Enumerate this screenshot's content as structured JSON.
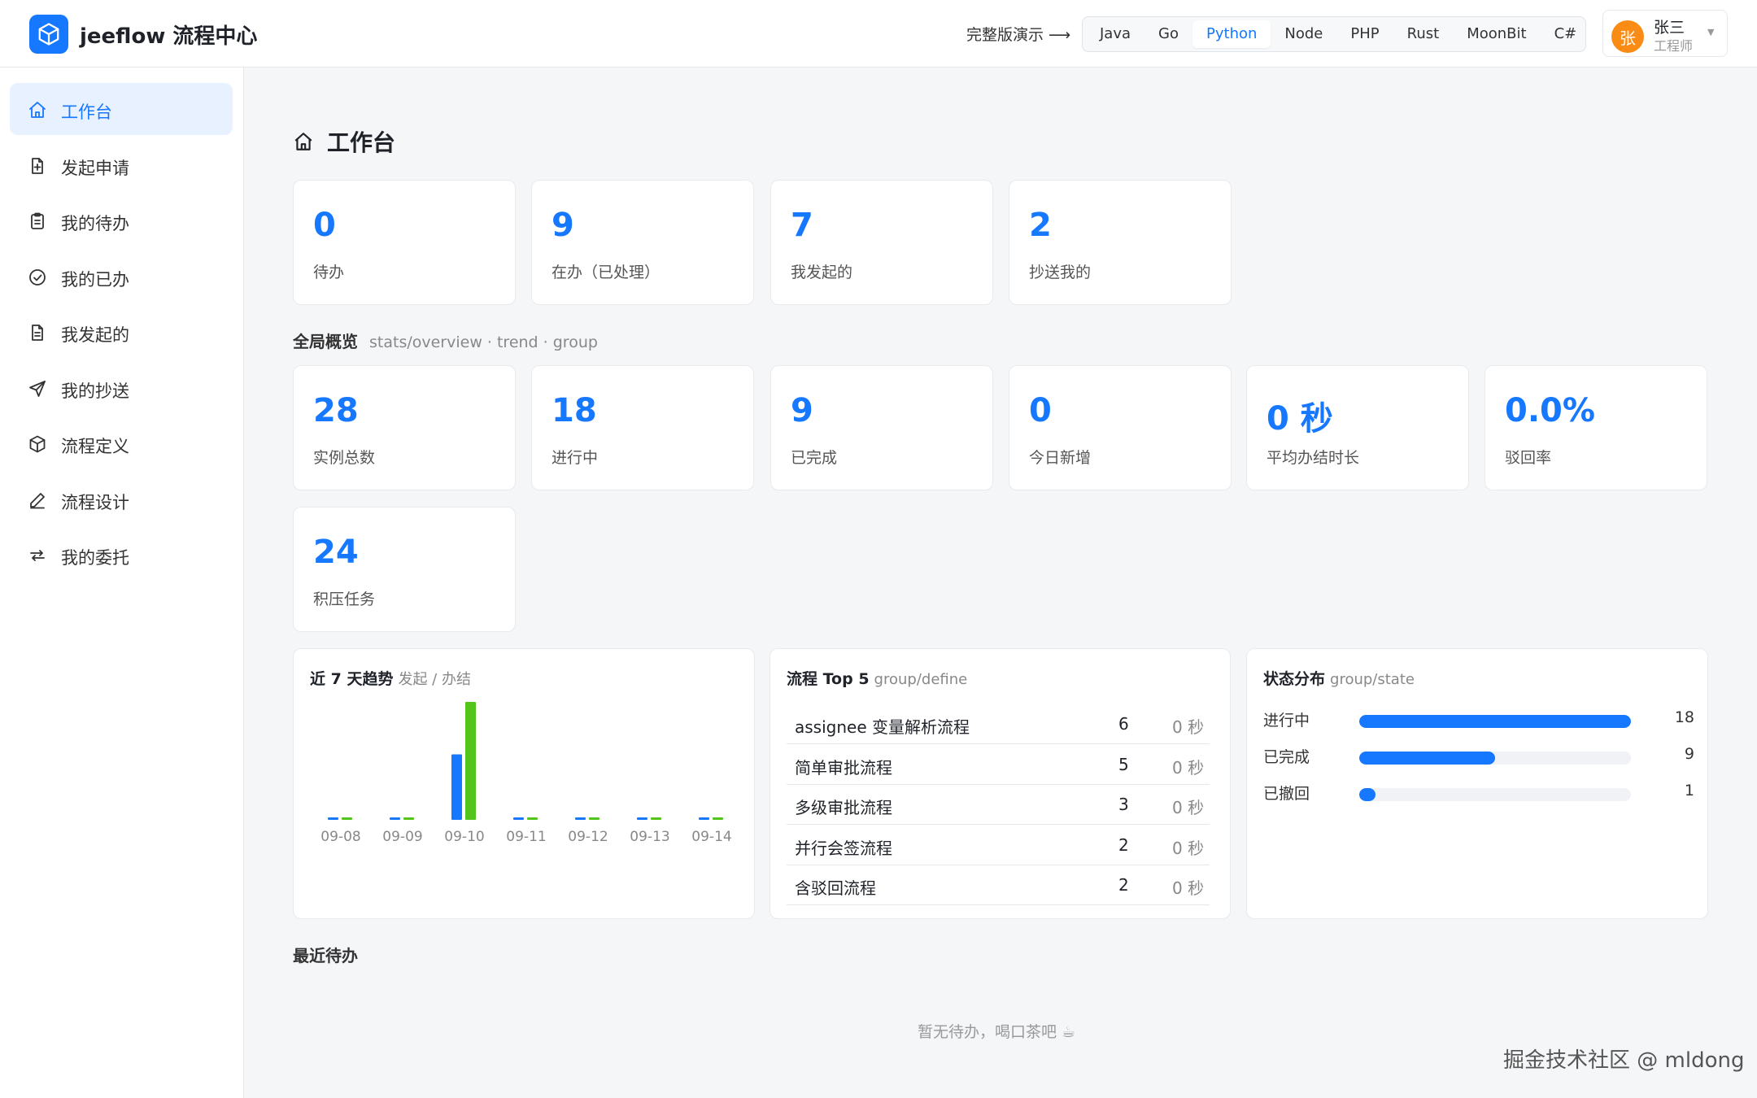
{
  "header": {
    "app_title": "jeeflow 流程中心",
    "demo_link": "完整版演示 ⟶",
    "languages": [
      "Java",
      "Go",
      "Python",
      "Node",
      "PHP",
      "Rust",
      "MoonBit",
      "C#"
    ],
    "active_language": "Python",
    "user": {
      "avatar_char": "张",
      "name": "张三",
      "role": "工程师"
    }
  },
  "sidebar": {
    "items": [
      {
        "label": "工作台",
        "icon": "home-icon",
        "active": true
      },
      {
        "label": "发起申请",
        "icon": "file-plus-icon",
        "active": false
      },
      {
        "label": "我的待办",
        "icon": "clipboard-icon",
        "active": false
      },
      {
        "label": "我的已办",
        "icon": "check-circle-icon",
        "active": false
      },
      {
        "label": "我发起的",
        "icon": "file-text-icon",
        "active": false
      },
      {
        "label": "我的抄送",
        "icon": "send-icon",
        "active": false
      },
      {
        "label": "流程定义",
        "icon": "box-icon",
        "active": false
      },
      {
        "label": "流程设计",
        "icon": "pen-icon",
        "active": false
      },
      {
        "label": "我的委托",
        "icon": "repeat-icon",
        "active": false
      }
    ]
  },
  "page_title": "工作台",
  "personal_stats": [
    {
      "value": "0",
      "label": "待办"
    },
    {
      "value": "9",
      "label": "在办（已处理）"
    },
    {
      "value": "7",
      "label": "我发起的"
    },
    {
      "value": "2",
      "label": "抄送我的"
    }
  ],
  "overview": {
    "title": "全局概览",
    "subtitle": "stats/overview · trend · group",
    "stats": [
      {
        "value": "28",
        "label": "实例总数"
      },
      {
        "value": "18",
        "label": "进行中"
      },
      {
        "value": "9",
        "label": "已完成"
      },
      {
        "value": "0",
        "label": "今日新增"
      },
      {
        "value": "0 秒",
        "label": "平均办结时长"
      },
      {
        "value": "0.0%",
        "label": "驳回率"
      },
      {
        "value": "24",
        "label": "积压任务"
      }
    ]
  },
  "trend_panel": {
    "title": "近 7 天趋势",
    "subtitle": "发起 / 办结",
    "colors": {
      "started": "#1677ff",
      "finished": "#52c41a"
    }
  },
  "chart_data": {
    "type": "bar",
    "categories": [
      "09-08",
      "09-09",
      "09-10",
      "09-11",
      "09-12",
      "09-13",
      "09-14"
    ],
    "series": [
      {
        "name": "发起",
        "values": [
          0,
          0,
          5,
          0,
          0,
          0,
          0
        ]
      },
      {
        "name": "办结",
        "values": [
          0,
          0,
          9,
          0,
          0,
          0,
          0
        ]
      }
    ],
    "title": "近 7 天趋势",
    "xlabel": "",
    "ylabel": "",
    "ylim": [
      0,
      9
    ]
  },
  "top5_panel": {
    "title": "流程 Top 5",
    "subtitle": "group/define",
    "rows": [
      {
        "name": "assignee 变量解析流程",
        "count": "6",
        "duration": "0 秒"
      },
      {
        "name": "简单审批流程",
        "count": "5",
        "duration": "0 秒"
      },
      {
        "name": "多级审批流程",
        "count": "3",
        "duration": "0 秒"
      },
      {
        "name": "并行会签流程",
        "count": "2",
        "duration": "0 秒"
      },
      {
        "name": "含驳回流程",
        "count": "2",
        "duration": "0 秒"
      }
    ]
  },
  "state_panel": {
    "title": "状态分布",
    "subtitle": "group/state",
    "max": 18,
    "rows": [
      {
        "name": "进行中",
        "value": 18
      },
      {
        "name": "已完成",
        "value": 9
      },
      {
        "name": "已撤回",
        "value": 1
      }
    ]
  },
  "recent_todo": {
    "title": "最近待办",
    "empty_text": "暂无待办，喝口茶吧 ☕"
  },
  "watermark": "掘金技术社区 @ mldong"
}
